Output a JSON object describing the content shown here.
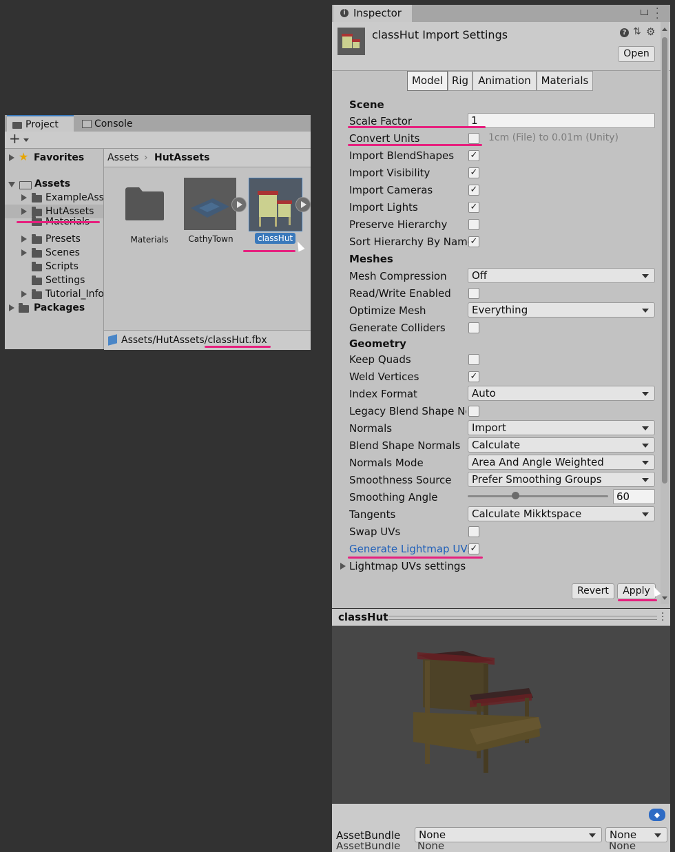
{
  "project": {
    "tabs": [
      "Project",
      "Console"
    ],
    "add_label": "+",
    "tree": {
      "favorites": "Favorites",
      "assets": "Assets",
      "children": [
        "ExampleAss",
        "HutAssets",
        "Materials",
        "Presets",
        "Scenes",
        "Scripts",
        "Settings",
        "Tutorial_Info"
      ],
      "packages": "Packages"
    },
    "breadcrumb": {
      "root": "Assets",
      "current": "HutAssets"
    },
    "grid_items": [
      "Materials",
      "CathyTown",
      "classHut"
    ],
    "path": {
      "prefix": "Assets/HutAssets/",
      "file": "classHut.fbx"
    }
  },
  "inspector": {
    "tab_label": "Inspector",
    "title": "classHut Import Settings",
    "open_button": "Open",
    "model_tabs": [
      "Model",
      "Rig",
      "Animation",
      "Materials"
    ],
    "active_tab": "Model",
    "scene_header": "Scene",
    "scale_factor_label": "Scale Factor",
    "scale_factor_value": "1",
    "convert_units_label": "Convert Units",
    "convert_units_hint": "1cm (File) to 0.01m (Unity)",
    "scene_checks": [
      {
        "label": "Import BlendShapes",
        "checked": true
      },
      {
        "label": "Import Visibility",
        "checked": true
      },
      {
        "label": "Import Cameras",
        "checked": true
      },
      {
        "label": "Import Lights",
        "checked": true
      },
      {
        "label": "Preserve Hierarchy",
        "checked": false
      },
      {
        "label": "Sort Hierarchy By Name",
        "checked": true
      }
    ],
    "meshes_header": "Meshes",
    "mesh_compression_label": "Mesh Compression",
    "mesh_compression_value": "Off",
    "read_write_label": "Read/Write Enabled",
    "optimize_mesh_label": "Optimize Mesh",
    "optimize_mesh_value": "Everything",
    "generate_colliders_label": "Generate Colliders",
    "geometry_header": "Geometry",
    "keep_quads_label": "Keep Quads",
    "weld_vertices_label": "Weld Vertices",
    "index_format_label": "Index Format",
    "index_format_value": "Auto",
    "legacy_blend_label": "Legacy Blend Shape No",
    "normals_label": "Normals",
    "normals_value": "Import",
    "blend_shape_normals_label": "Blend Shape Normals",
    "blend_shape_normals_value": "Calculate",
    "normals_mode_label": "Normals Mode",
    "normals_mode_value": "Area And Angle Weighted",
    "smoothness_source_label": "Smoothness Source",
    "smoothness_source_value": "Prefer Smoothing Groups",
    "smoothing_angle_label": "Smoothing Angle",
    "smoothing_angle_value": "60",
    "smoothing_angle_fraction": 0.33,
    "tangents_label": "Tangents",
    "tangents_value": "Calculate Mikktspace",
    "swap_uvs_label": "Swap UVs",
    "generate_lightmap_label": "Generate Lightmap UVs",
    "lightmap_settings_label": "Lightmap UVs settings",
    "revert_button": "Revert",
    "apply_button": "Apply"
  },
  "preview": {
    "title": "classHut"
  },
  "assetbundle": {
    "label": "AssetBundle",
    "name_value": "None",
    "variant_value": "None"
  },
  "colors": {
    "highlight": "#e6207e",
    "selection": "#3a79bb",
    "link_blue": "#1f5fb8"
  }
}
